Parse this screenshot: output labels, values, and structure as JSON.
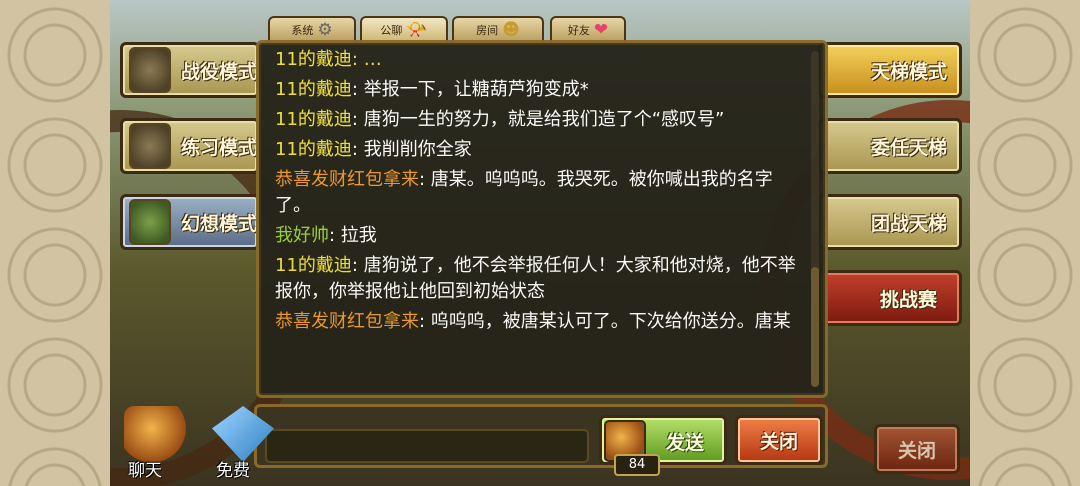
{
  "tabs": [
    {
      "label": "系统",
      "icon": "gear-icon",
      "glyph": "⚙"
    },
    {
      "label": "公聊",
      "icon": "horn-icon",
      "glyph": "📯"
    },
    {
      "label": "房间",
      "icon": "character-icon",
      "glyph": "☻"
    },
    {
      "label": "好友",
      "icon": "heart-icon",
      "glyph": "❤"
    }
  ],
  "left_modes": [
    {
      "label": "战役模式",
      "icon": "castle-icon"
    },
    {
      "label": "练习模式",
      "icon": "cards-icon"
    },
    {
      "label": "幻想模式",
      "icon": "map-icon"
    }
  ],
  "right_modes": [
    {
      "label": "天梯模式",
      "icon": "ladder-star-icon"
    },
    {
      "label": "委任天梯",
      "icon": "appoint-star-icon"
    },
    {
      "label": "团战天梯",
      "icon": "team-star-icon"
    },
    {
      "label": "挑战赛",
      "icon": "challenge-star-icon"
    }
  ],
  "chat": {
    "cut_top": "11的戴迪: …",
    "messages": [
      {
        "sender": "11的戴迪",
        "color": "yellow",
        "text": ": 举报一下，让糖葫芦狗变成*"
      },
      {
        "sender": "11的戴迪",
        "color": "yellow",
        "text": ": 唐狗一生的努力，就是给我们造了个“感叹号”"
      },
      {
        "sender": "11的戴迪",
        "color": "yellow",
        "text": ": 我削削你全家"
      },
      {
        "sender": "恭喜发财红包拿来",
        "color": "orange",
        "text": ": 唐某。呜呜呜。我哭死。被你喊出我的名字了。"
      },
      {
        "sender": "我好帅",
        "color": "green",
        "text": ": 拉我"
      },
      {
        "sender": "11的戴迪",
        "color": "yellow",
        "text": ": 唐狗说了，他不会举报任何人！大家和他对烧，他不举报你，你举报他让他回到初始状态"
      },
      {
        "sender": "恭喜发财红包拿来",
        "color": "orange",
        "text": ": 呜呜呜，被唐某认可了。下次给你送分。唐某"
      }
    ]
  },
  "input": {
    "value": "",
    "placeholder": ""
  },
  "send": {
    "label": "发送",
    "count": "84"
  },
  "close_chat_label": "关闭",
  "outer_close_label": "关闭",
  "bottom": [
    {
      "label": "聊天",
      "icon": "horn-icon"
    },
    {
      "label": "免费",
      "icon": "gem-icon"
    }
  ]
}
